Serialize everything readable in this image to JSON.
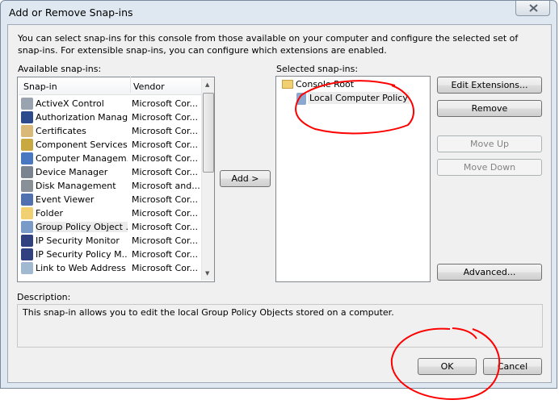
{
  "window": {
    "title": "Add or Remove Snap-ins"
  },
  "intro": "You can select snap-ins for this console from those available on your computer and configure the selected set of snap-ins. For extensible snap-ins, you can configure which extensions are enabled.",
  "available": {
    "label": "Available snap-ins:",
    "columns": [
      "Snap-in",
      "Vendor"
    ],
    "items": [
      {
        "name": "ActiveX Control",
        "vendor": "Microsoft Cor...",
        "icon": "activex-icon",
        "color": "#9aa4b0"
      },
      {
        "name": "Authorization Manager",
        "vendor": "Microsoft Cor...",
        "icon": "authorization-icon",
        "color": "#2c4a8c"
      },
      {
        "name": "Certificates",
        "vendor": "Microsoft Cor...",
        "icon": "certificate-icon",
        "color": "#d9b878"
      },
      {
        "name": "Component Services",
        "vendor": "Microsoft Cor...",
        "icon": "component-services-icon",
        "color": "#c8a840"
      },
      {
        "name": "Computer Managem...",
        "vendor": "Microsoft Cor...",
        "icon": "computer-management-icon",
        "color": "#4a78c0"
      },
      {
        "name": "Device Manager",
        "vendor": "Microsoft Cor...",
        "icon": "device-manager-icon",
        "color": "#7a8490"
      },
      {
        "name": "Disk Management",
        "vendor": "Microsoft and...",
        "icon": "disk-icon",
        "color": "#8a9098"
      },
      {
        "name": "Event Viewer",
        "vendor": "Microsoft Cor...",
        "icon": "event-viewer-icon",
        "color": "#5070b0"
      },
      {
        "name": "Folder",
        "vendor": "Microsoft Cor...",
        "icon": "folder-icon",
        "color": "#f0d070"
      },
      {
        "name": "Group Policy Object ...",
        "vendor": "Microsoft Cor...",
        "icon": "policy-scroll-icon",
        "color": "#7a9ac8",
        "selected": true
      },
      {
        "name": "IP Security Monitor",
        "vendor": "Microsoft Cor...",
        "icon": "ip-security-icon",
        "color": "#304080"
      },
      {
        "name": "IP Security Policy M...",
        "vendor": "Microsoft Cor...",
        "icon": "ip-security-icon",
        "color": "#304080"
      },
      {
        "name": "Link to Web Address",
        "vendor": "Microsoft Cor...",
        "icon": "web-link-icon",
        "color": "#a0b8d0"
      }
    ]
  },
  "add_button": "Add >",
  "selected": {
    "label": "Selected snap-ins:",
    "root": "Console Root",
    "child": "Local Computer Policy"
  },
  "buttons": {
    "edit_extensions": "Edit Extensions...",
    "remove": "Remove",
    "move_up": "Move Up",
    "move_down": "Move Down",
    "advanced": "Advanced..."
  },
  "description": {
    "label": "Description:",
    "text": "This snap-in allows you to edit the local Group Policy Objects stored on a computer."
  },
  "ok": "OK",
  "cancel": "Cancel",
  "annotation_color": "#ff0000"
}
